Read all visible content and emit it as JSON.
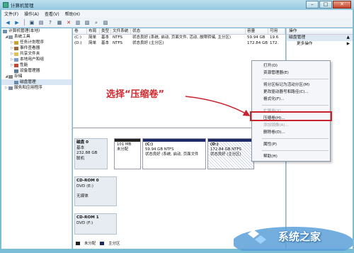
{
  "window": {
    "title": "计算机管理"
  },
  "menu": [
    "文件(F)",
    "操作(A)",
    "查看(V)",
    "帮助(H)"
  ],
  "tree": [
    {
      "label": "计算机管理(本地)",
      "level": 0
    },
    {
      "label": "系统工具",
      "level": 1
    },
    {
      "label": "任务计划程序",
      "level": 2
    },
    {
      "label": "事件查看器",
      "level": 2
    },
    {
      "label": "共享文件夹",
      "level": 2
    },
    {
      "label": "本地用户和组",
      "level": 2
    },
    {
      "label": "性能",
      "level": 2
    },
    {
      "label": "设备管理器",
      "level": 2
    },
    {
      "label": "存储",
      "level": 1
    },
    {
      "label": "磁盘管理",
      "level": 2
    },
    {
      "label": "服务和应用程序",
      "level": 1
    }
  ],
  "columns": [
    "卷",
    "布局",
    "类型",
    "文件系统",
    "状态",
    "容量",
    "可用"
  ],
  "volumes": [
    {
      "vol": "(C:)",
      "layout": "简单",
      "type": "基本",
      "fs": "NTFS",
      "status": "状态良好 (系统, 启动, 页面文件, 活动, 故障转储, 主分区)",
      "capacity": "59.94 GB",
      "free": "19.6"
    },
    {
      "vol": "(D:)",
      "layout": "简单",
      "type": "基本",
      "fs": "NTFS",
      "status": "状态良好 (主分区)",
      "capacity": "172.84 GB",
      "free": "172."
    }
  ],
  "disks": [
    {
      "name": "磁盘 0",
      "type": "基本",
      "size": "232.88 GB",
      "state": "联机"
    },
    {
      "name": "CD-ROM 0",
      "type": "DVD (E:)",
      "size": "",
      "state": "无媒体"
    },
    {
      "name": "CD-ROM 1",
      "type": "DVD (F:)",
      "size": "",
      "state": ""
    }
  ],
  "partitions": [
    {
      "title": "",
      "size": "101 MB",
      "status": "未分配"
    },
    {
      "title": "(C:)",
      "size": "59.94 GB NTFS",
      "status": "状态良好 (系统, 启动, 页面文件"
    },
    {
      "title": "(D:)",
      "size": "172.84 GB NTFS",
      "status": "状态良好 (主分区)"
    }
  ],
  "legend": [
    "未分配",
    "主分区"
  ],
  "actions": {
    "header": "操作",
    "sub": "磁盘管理",
    "item": "更多操作"
  },
  "context_menu": [
    {
      "label": "打开(O)",
      "disabled": false
    },
    {
      "label": "资源管理器(E)",
      "disabled": false
    },
    {
      "sep": true
    },
    {
      "label": "将分区标记为活动分区(M)",
      "disabled": false
    },
    {
      "label": "更改驱动器号和路径(C)...",
      "disabled": false
    },
    {
      "label": "格式化(F)...",
      "disabled": false
    },
    {
      "sep": true
    },
    {
      "label": "扩展卷(X)...",
      "disabled": true
    },
    {
      "label": "压缩卷(H)...",
      "disabled": false
    },
    {
      "label": "添加镜像(A)...",
      "disabled": true
    },
    {
      "label": "删除卷(D)...",
      "disabled": false
    },
    {
      "sep": true
    },
    {
      "label": "属性(P)",
      "disabled": false
    },
    {
      "sep": true
    },
    {
      "label": "帮助(H)",
      "disabled": false
    }
  ],
  "annotation": "选择“压缩卷”",
  "watermark": {
    "text": "系统之家",
    "url": "www.xitongzhijia.net"
  },
  "colors": {
    "accent_red": "#c8232c",
    "partition_bar": "#1e2a66"
  }
}
